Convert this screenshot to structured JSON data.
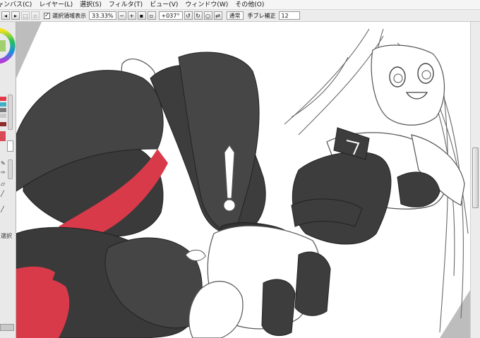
{
  "menu": {
    "items": [
      "ャンバス(C)",
      "レイヤー(L)",
      "選択(S)",
      "フィルタ(T)",
      "ビュー(V)",
      "ウィンドウ(W)",
      "その他(O)"
    ]
  },
  "toolbar": {
    "selection_checkbox_checked": true,
    "selection_label": "選択領域表示",
    "zoom_value": "33.33%",
    "rotation_value": "+037°",
    "blend_mode": "通常",
    "stabilizer_label": "手ブレ補正",
    "stabilizer_value": "12"
  },
  "left_panel": {
    "tool_label": "選択",
    "swatch_colors": [
      "#e23a48",
      "#3fb0c8",
      "#7a7a7a",
      "#c9c9c9",
      "#8f2b2b",
      "#d94a55"
    ]
  },
  "colors": {
    "accent_red": "#d83a4a",
    "stocking_gray": "#3d3d3d",
    "canvas_bg": "#ffffff"
  },
  "icons": [
    "prev-icon",
    "next-icon",
    "rotate-left-icon",
    "rotate-right-icon",
    "reset-rotation-icon",
    "flip-icon",
    "color-wheel-icon",
    "brush-icon",
    "eraser-icon",
    "pen-icon"
  ]
}
